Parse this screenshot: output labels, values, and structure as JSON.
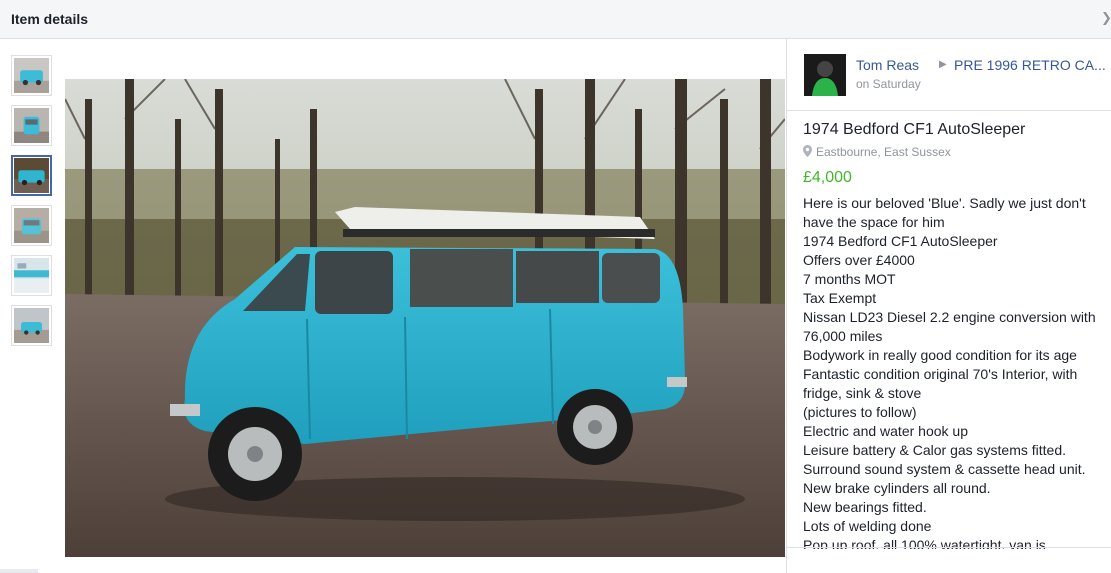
{
  "header": {
    "title": "Item details",
    "close_icon": "close-icon"
  },
  "thumbnails": [
    {
      "name": "thumbnail-1",
      "active": false
    },
    {
      "name": "thumbnail-2",
      "active": false
    },
    {
      "name": "thumbnail-3",
      "active": true
    },
    {
      "name": "thumbnail-4",
      "active": false
    },
    {
      "name": "thumbnail-5",
      "active": false
    },
    {
      "name": "thumbnail-6",
      "active": false
    }
  ],
  "seller": {
    "name": "Tom Reas",
    "group": "PRE 1996 RETRO CA...",
    "posted": "on Saturday"
  },
  "item": {
    "title": "1974 Bedford CF1 AutoSleeper",
    "location": "Eastbourne, East Sussex",
    "price": "£4,000",
    "description_lines": [
      "Here is our beloved 'Blue'. Sadly we just don't",
      "have the space for him",
      "1974 Bedford CF1 AutoSleeper",
      "Offers over £4000",
      "7 months MOT",
      "Tax Exempt",
      "Nissan LD23 Diesel 2.2 engine conversion with",
      "76,000 miles",
      "Bodywork in really good condition for its age",
      "Fantastic condition original 70's Interior, with",
      "fridge, sink & stove",
      "(pictures to follow)",
      "Electric and water hook up",
      "Leisure battery & Calor gas systems fitted.",
      "Surround sound system & cassette head unit.",
      "New brake cylinders all round.",
      "New bearings fitted.",
      "Lots of welding done",
      "Pop up roof, all 100% watertight, van is"
    ]
  },
  "colors": {
    "link": "#365899",
    "price": "#42b72a",
    "van": "#2fb5cf"
  }
}
